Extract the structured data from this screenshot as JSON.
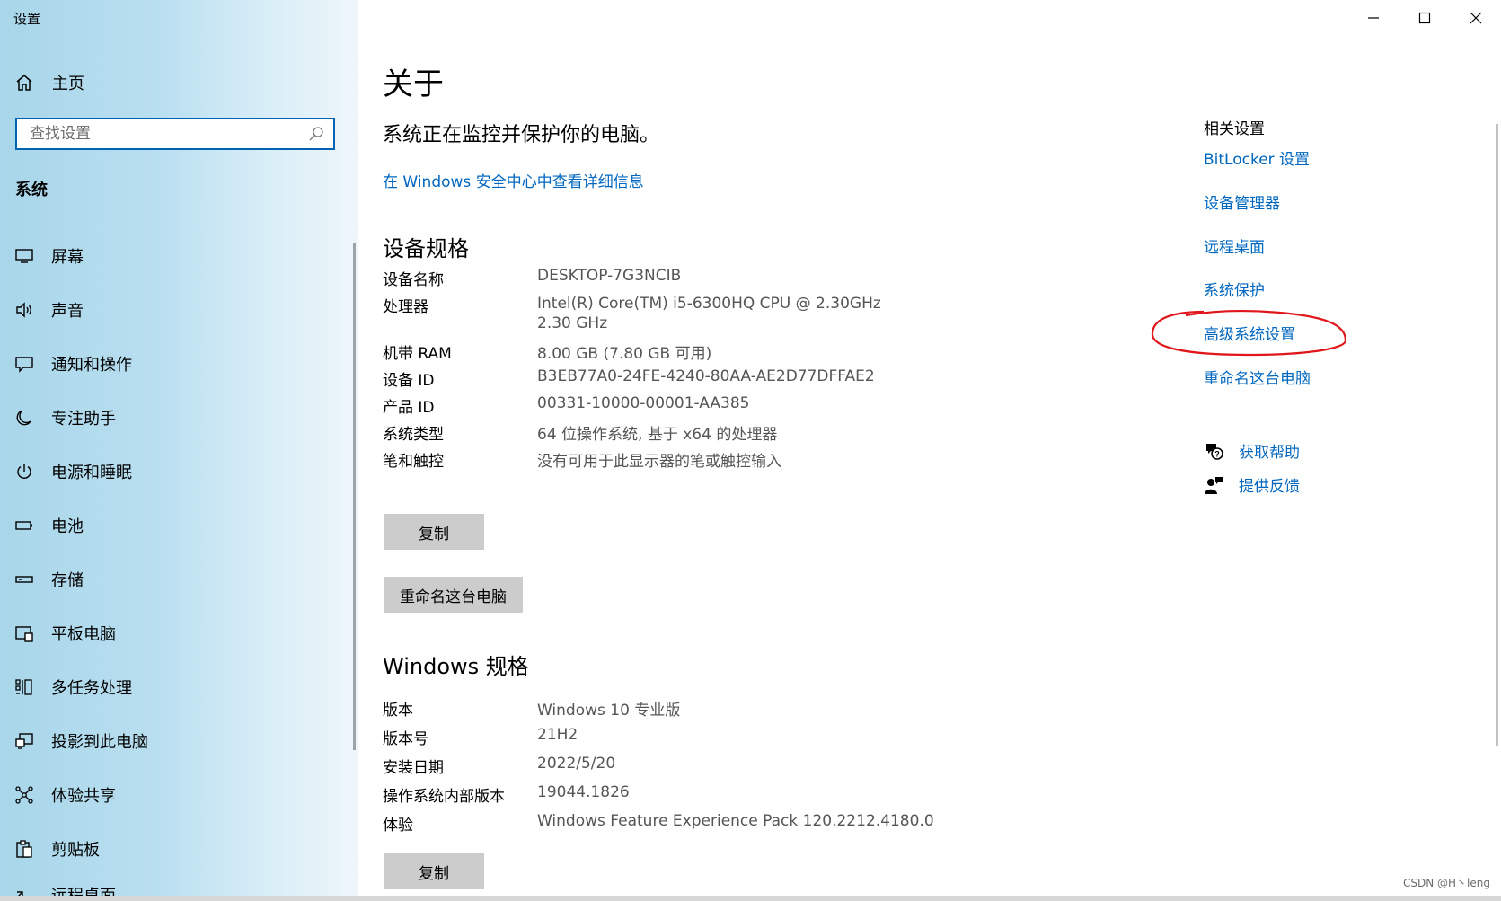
{
  "window": {
    "title": "设置",
    "controls": [
      "minimize-icon",
      "maximize-icon",
      "close-icon"
    ]
  },
  "sidebar": {
    "home_label": "主页",
    "search_placeholder": "查找设置",
    "section_title": "系统",
    "items": [
      {
        "label": "屏幕",
        "icon": "monitor-icon"
      },
      {
        "label": "声音",
        "icon": "speaker-icon"
      },
      {
        "label": "通知和操作",
        "icon": "notification-icon"
      },
      {
        "label": "专注助手",
        "icon": "moon-icon"
      },
      {
        "label": "电源和睡眠",
        "icon": "power-icon"
      },
      {
        "label": "电池",
        "icon": "battery-icon"
      },
      {
        "label": "存储",
        "icon": "storage-icon"
      },
      {
        "label": "平板电脑",
        "icon": "tablet-icon"
      },
      {
        "label": "多任务处理",
        "icon": "multitask-icon"
      },
      {
        "label": "投影到此电脑",
        "icon": "project-icon"
      },
      {
        "label": "体验共享",
        "icon": "share-icon"
      },
      {
        "label": "剪贴板",
        "icon": "clipboard-icon"
      },
      {
        "label": "远程桌面",
        "icon": "remote-desktop-icon"
      }
    ]
  },
  "main": {
    "title": "关于",
    "protect_text": "系统正在监控并保护你的电脑。",
    "security_link": "在 Windows 安全中心中查看详细信息",
    "device_specs": {
      "heading": "设备规格",
      "rows": [
        {
          "label": "设备名称",
          "value": "DESKTOP-7G3NCIB"
        },
        {
          "label": "处理器",
          "value": "Intel(R) Core(TM) i5-6300HQ CPU @ 2.30GHz",
          "value2": "2.30 GHz"
        },
        {
          "label": "机带 RAM",
          "value": "8.00 GB (7.80 GB 可用)"
        },
        {
          "label": "设备 ID",
          "value": "B3EB77A0-24FE-4240-80AA-AE2D77DFFAE2"
        },
        {
          "label": "产品 ID",
          "value": "00331-10000-00001-AA385"
        },
        {
          "label": "系统类型",
          "value": "64 位操作系统, 基于 x64 的处理器"
        },
        {
          "label": "笔和触控",
          "value": "没有可用于此显示器的笔或触控输入"
        }
      ],
      "copy_button": "复制",
      "rename_button": "重命名这台电脑"
    },
    "windows_specs": {
      "heading": "Windows 规格",
      "rows": [
        {
          "label": "版本",
          "value": "Windows 10 专业版"
        },
        {
          "label": "版本号",
          "value": "21H2"
        },
        {
          "label": "安装日期",
          "value": "2022/5/20"
        },
        {
          "label": "操作系统内部版本",
          "value": "19044.1826"
        },
        {
          "label": "体验",
          "value": "Windows Feature Experience Pack 120.2212.4180.0"
        }
      ],
      "copy_button": "复制"
    }
  },
  "related": {
    "heading": "相关设置",
    "links": [
      "BitLocker 设置",
      "设备管理器",
      "远程桌面",
      "系统保护",
      "高级系统设置",
      "重命名这台电脑"
    ],
    "annotation_color": "#e0161b",
    "help": [
      {
        "label": "获取帮助",
        "icon": "help-chat-icon"
      },
      {
        "label": "提供反馈",
        "icon": "feedback-icon"
      }
    ]
  },
  "watermark": "CSDN @H丶leng",
  "colors": {
    "link": "#0067c0",
    "search_border": "#0063b1",
    "button": "#cccccc"
  }
}
